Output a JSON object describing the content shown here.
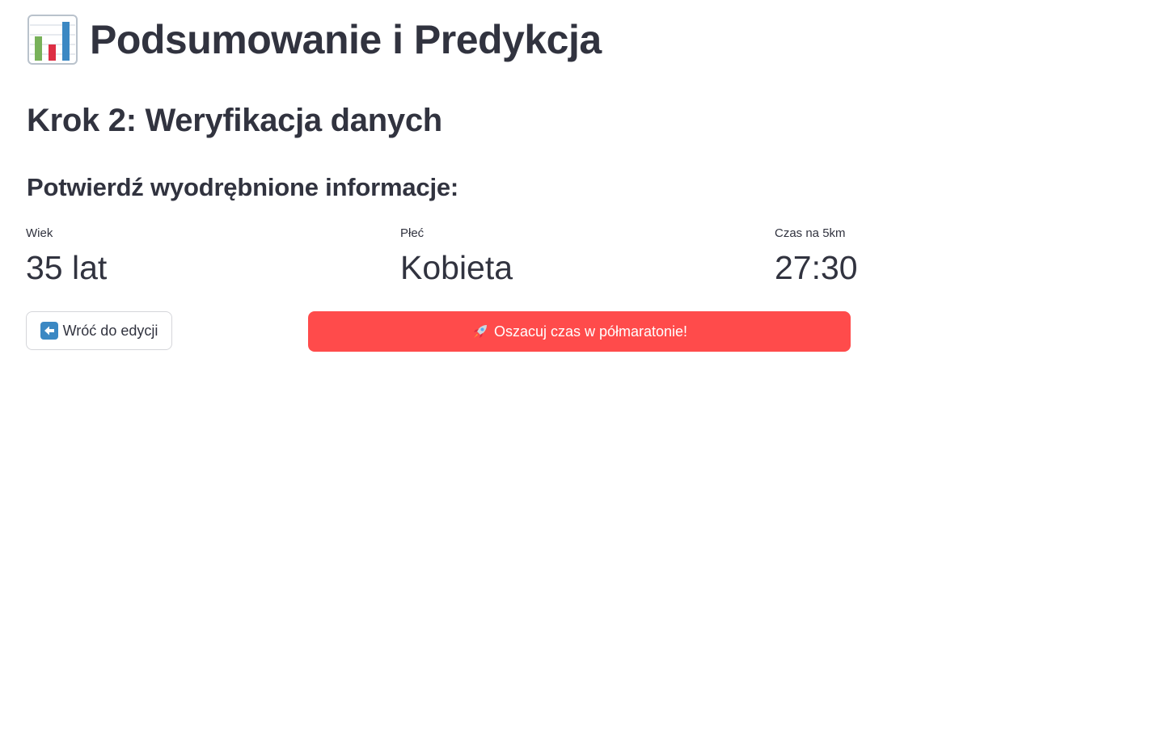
{
  "header": {
    "icon": "bar-chart-icon",
    "title": "Podsumowanie i Predykcja"
  },
  "step": {
    "title": "Krok 2: Weryfikacja danych"
  },
  "section": {
    "title": "Potwierdź wyodrębnione informacje:"
  },
  "metrics": [
    {
      "label": "Wiek",
      "value": "35 lat"
    },
    {
      "label": "Płeć",
      "value": "Kobieta"
    },
    {
      "label": "Czas na 5km",
      "value": "27:30"
    }
  ],
  "actions": {
    "back": {
      "icon": "left-arrow-icon",
      "label": "Wróć do edycji"
    },
    "predict": {
      "icon": "rocket-icon",
      "label": "Oszacuj czas w półmaratonie!"
    }
  },
  "colors": {
    "primary": "#ff4b4b",
    "text": "#31333f",
    "border": "#d5d6da"
  }
}
